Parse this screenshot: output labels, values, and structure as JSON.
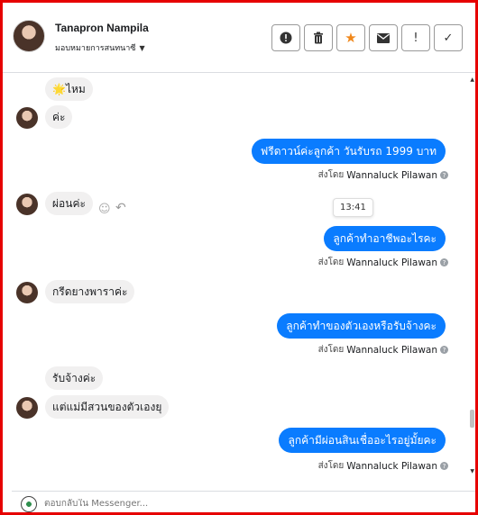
{
  "contact": {
    "name": "Tanapron Nampila",
    "status": "มอบหมายการสนทนาซี"
  },
  "actions": [
    {
      "name": "report-button",
      "glyph": "!"
    },
    {
      "name": "delete-button",
      "glyph": "🗑"
    },
    {
      "name": "star-button",
      "glyph": "★"
    },
    {
      "name": "mail-button",
      "glyph": "✉"
    },
    {
      "name": "flag-button",
      "glyph": "!"
    },
    {
      "name": "done-button",
      "glyph": "✓"
    }
  ],
  "messages": {
    "m1": "🌟ไหม",
    "m2": "ค่ะ",
    "m3": "ฟรีดาวน์ค่ะลูกค้า วันรับรถ 1999  บาท",
    "m4": "ผ่อนค่ะ",
    "m5": "ลูกค้าทำอาชีพอะไรคะ",
    "m6": "กรีดยางพาราค่ะ",
    "m7": "ลูกค้าทำของตัวเองหรือรับจ้างคะ",
    "m8": "รับจ้างค่ะ",
    "m9": "แต่แม่มีสวนของตัวเองยุ",
    "m10": "ลูกค้ามีผ่อนสินเชื่ออะไรอยู่มั้ยคะ"
  },
  "sent_by_prefix": "ส่งโดย",
  "agent": "Wannaluck Pilawan",
  "time_tooltip": "13:41",
  "composer": {
    "placeholder": "ตอบกลับใน Messenger..."
  }
}
